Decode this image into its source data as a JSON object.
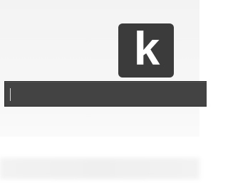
{
  "logo": {
    "letter": "k",
    "background": "#3b3b3b",
    "foreground": "#ffffff"
  },
  "search": {
    "value": "",
    "placeholder": "",
    "background": "#434343"
  }
}
